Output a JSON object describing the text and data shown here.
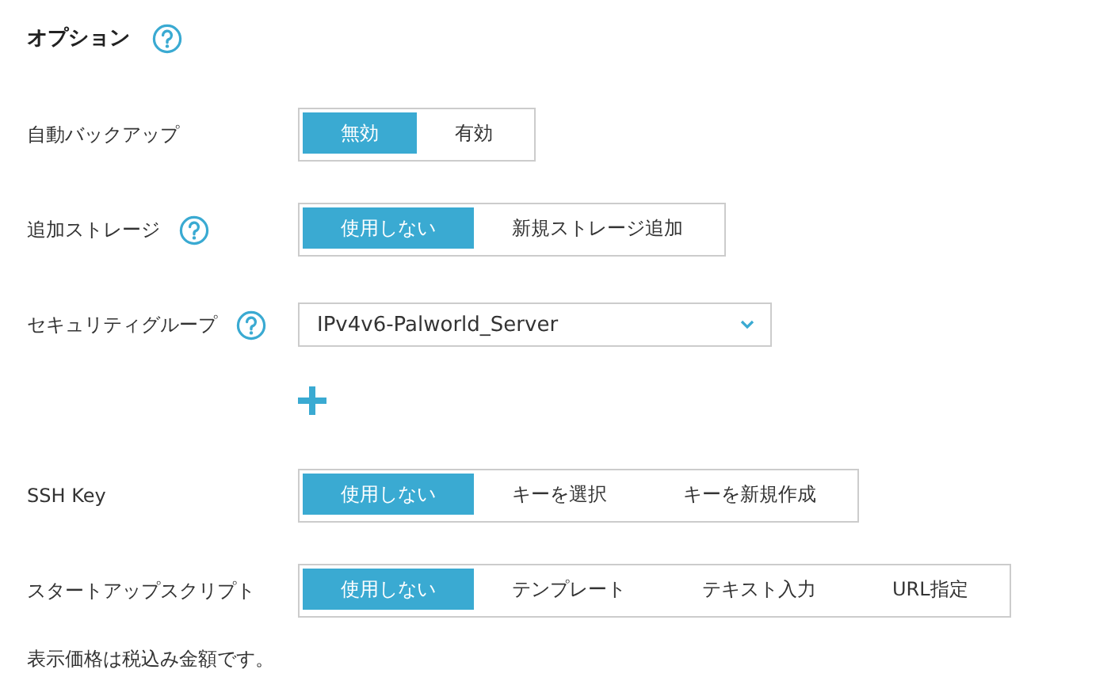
{
  "section": {
    "title": "オプション"
  },
  "rows": [
    {
      "kind": "segmented",
      "label": "自動バックアップ",
      "help": false,
      "options": [
        {
          "label": "無効",
          "selected": true
        },
        {
          "label": "有効",
          "selected": false
        }
      ]
    },
    {
      "kind": "segmented",
      "label": "追加ストレージ",
      "help": true,
      "options": [
        {
          "label": "使用しない",
          "selected": true
        },
        {
          "label": "新規ストレージ追加",
          "selected": false
        }
      ]
    },
    {
      "kind": "select",
      "label": "セキュリティグループ",
      "help": true,
      "value": "IPv4v6-Palworld_Server"
    },
    {
      "kind": "add"
    },
    {
      "kind": "segmented",
      "label": "SSH Key",
      "help": false,
      "options": [
        {
          "label": "使用しない",
          "selected": true
        },
        {
          "label": "キーを選択",
          "selected": false
        },
        {
          "label": "キーを新規作成",
          "selected": false
        }
      ]
    },
    {
      "kind": "segmented",
      "label": "スタートアップスクリプト",
      "help": false,
      "options": [
        {
          "label": "使用しない",
          "selected": true
        },
        {
          "label": "テンプレート",
          "selected": false
        },
        {
          "label": "テキスト入力",
          "selected": false
        },
        {
          "label": "URL指定",
          "selected": false
        }
      ]
    }
  ],
  "note": "表示価格は税込み金額です。"
}
